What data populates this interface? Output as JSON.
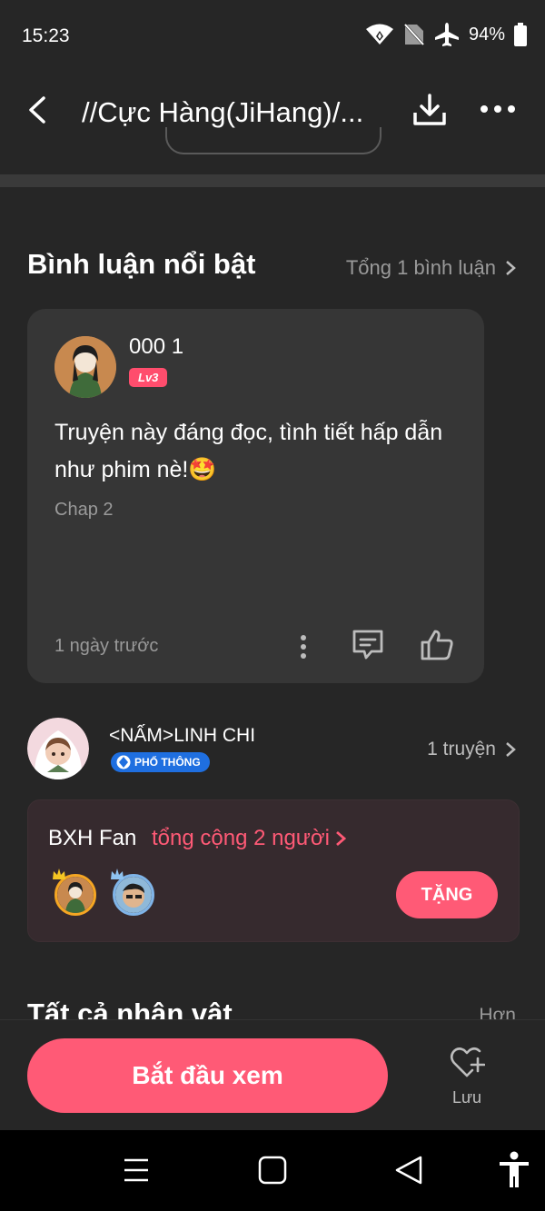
{
  "status_bar": {
    "time": "15:23",
    "battery": "94%"
  },
  "top_bar": {
    "title": "//Cực Hàng(JiHang)/..."
  },
  "highlighted_comments": {
    "title": "Bình luận nổi bật",
    "total_link": "Tổng 1 bình luận",
    "comment": {
      "username": "000 1",
      "level": "Lv3",
      "text": "Truyện này đáng đọc, tình tiết hấp dẫn như phim nè!🤩",
      "chapter": "Chap 2",
      "time": "1 ngày trước"
    }
  },
  "author": {
    "name": "<NẤM>LINH CHI",
    "badge": "PHỔ THÔNG",
    "stories_link": "1 truyện"
  },
  "fan_ranking": {
    "title": "BXH Fan",
    "total": "tổng cộng 2 người",
    "gift_button": "TẶNG"
  },
  "characters_section": {
    "title": "Tất cả nhân vật",
    "more_link": "Hơn"
  },
  "bottom_bar": {
    "watch_button": "Bắt đầu xem",
    "save_label": "Lưu"
  },
  "colors": {
    "accent": "#ff5a76",
    "background": "#262626",
    "card": "#363636",
    "badge_blue": "#1f6fe0"
  }
}
